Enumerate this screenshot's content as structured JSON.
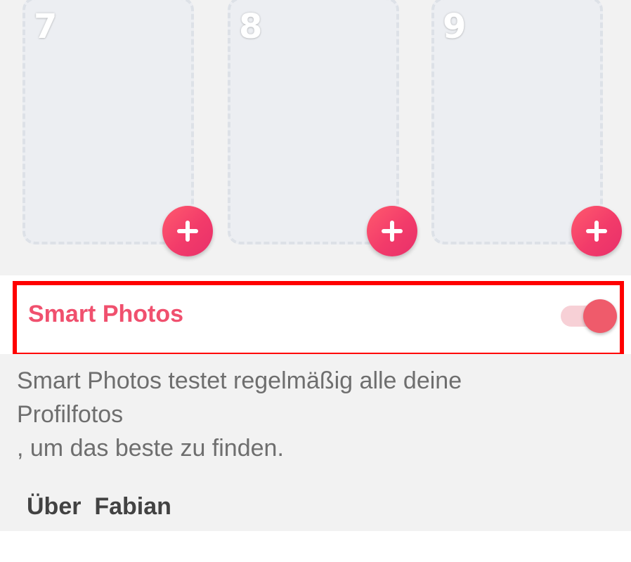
{
  "photo_slots": [
    {
      "number": "7",
      "action": "+"
    },
    {
      "number": "8",
      "action": "+"
    },
    {
      "number": "9",
      "action": "+"
    }
  ],
  "smart_photos": {
    "label": "Smart Photos",
    "enabled": true,
    "description_lines": [
      "Smart Photos testet regelmäßig alle deine",
      "Profilfotos",
      ", um das beste zu finden."
    ]
  },
  "about_section": {
    "title": "Über  Fabian"
  },
  "colors": {
    "accent": "#f0506e",
    "add_button": "#f23b6a",
    "toggle_knob": "#ef5b6b",
    "toggle_track": "#f7d0d6",
    "highlight_box": "#ff0000"
  },
  "icons": {
    "add": "plus-icon"
  }
}
